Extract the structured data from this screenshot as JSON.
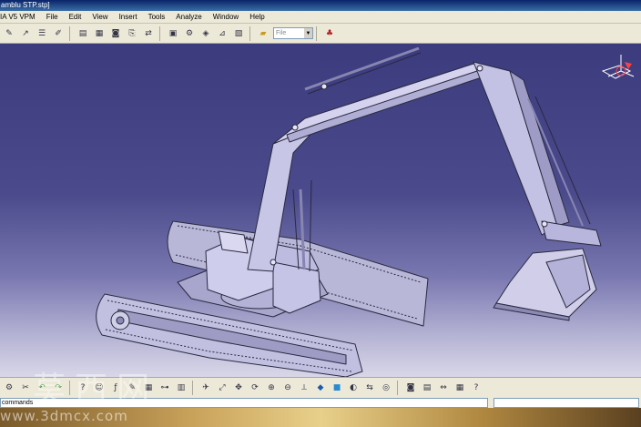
{
  "window": {
    "title": "amblu STP.stp]"
  },
  "menu": [
    "IA V5 VPM",
    "File",
    "Edit",
    "View",
    "Insert",
    "Tools",
    "Analyze",
    "Window",
    "Help"
  ],
  "toolbar_top": {
    "buttons_a": [
      "wand-icon",
      "sketch-arrow-icon",
      "list-icon",
      "pen-tool-icon"
    ],
    "buttons_b": [
      "product-tree-icon",
      "catalog-icon",
      "camera-icon",
      "save-as-icon",
      "replace-icon"
    ],
    "buttons_c": [
      "section-view-icon",
      "generate-icon",
      "analyze-icon",
      "measure-icon",
      "publish-icon"
    ],
    "open_folder_icon": "folder-open-icon",
    "file_combo": "File",
    "extra_icon": "knowledge-icon"
  },
  "toolbar_bottom": {
    "buttons_a": [
      "settings-icon",
      "scissors-icon",
      "undo-icon",
      "redo-icon"
    ],
    "buttons_b": [
      "help-icon",
      "whats-this-icon",
      "formula-icon",
      "sketch-icon",
      "table-icon",
      "tree-icon",
      "grid-icon"
    ],
    "buttons_c": [
      "fly-icon",
      "fit-all-icon",
      "pan-icon",
      "rotate-icon",
      "zoom-in-icon",
      "zoom-out-icon",
      "normal-view-icon",
      "iso-view-icon",
      "shading-icon",
      "hide-show-icon",
      "swap-icon",
      "material-icon"
    ],
    "buttons_d": [
      "camera-icon",
      "catalog-icon",
      "compass-icon",
      "table-icon",
      "help-icon"
    ]
  },
  "command": {
    "label": "commands"
  },
  "watermark": {
    "chars": "莫西网",
    "url": "www.3dmcx.com"
  },
  "colors": {
    "viewport_top": "#3b3b7e",
    "viewport_bottom": "#d8d7e8",
    "model_fill": "#c8c6e6",
    "model_edge": "#2a2a40"
  }
}
